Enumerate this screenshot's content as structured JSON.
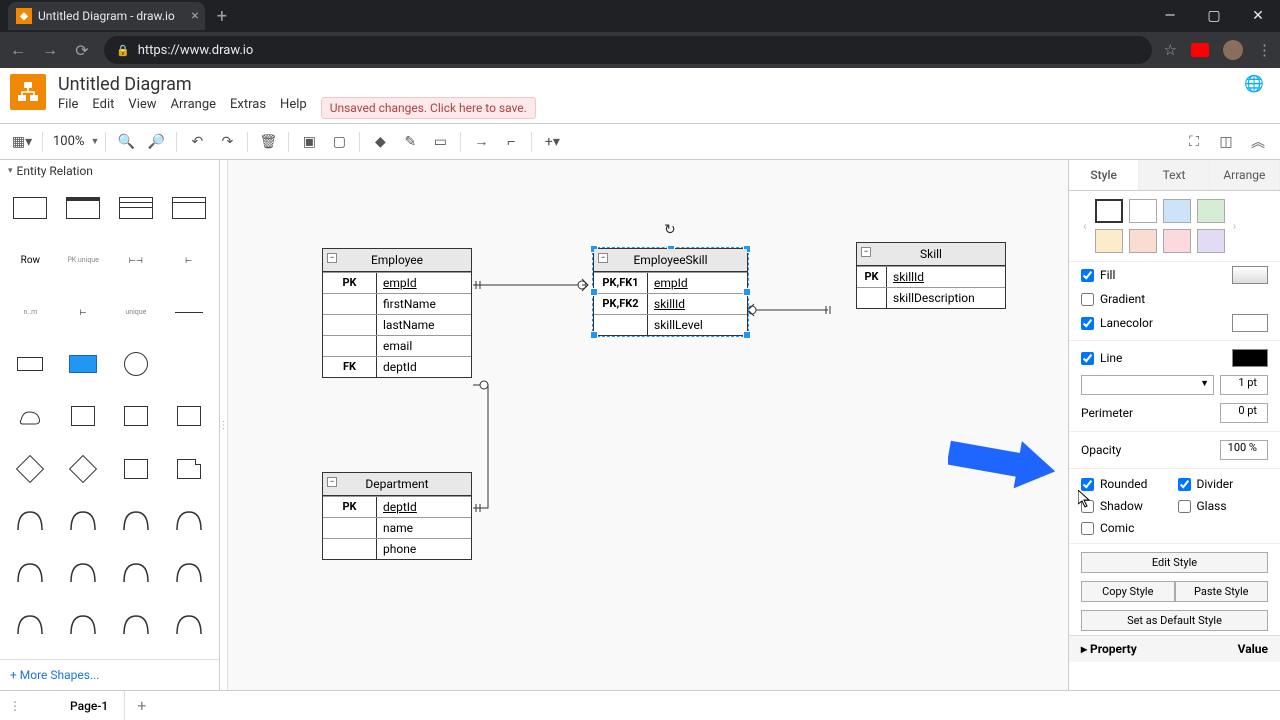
{
  "browser": {
    "tab_title": "Untitled Diagram - draw.io",
    "url": "https://www.draw.io"
  },
  "header": {
    "doc_title": "Untitled Diagram",
    "menu": [
      "File",
      "Edit",
      "View",
      "Arrange",
      "Extras",
      "Help"
    ],
    "unsaved": "Unsaved changes. Click here to save."
  },
  "toolbar": {
    "zoom": "100%"
  },
  "sidebar": {
    "section": "Entity Relation",
    "row_label": "Row",
    "more": "+ More Shapes..."
  },
  "canvas": {
    "tables": {
      "employee": {
        "title": "Employee",
        "rows": [
          {
            "key": "PK",
            "col": "empId",
            "u": true
          },
          {
            "key": "",
            "col": "firstName"
          },
          {
            "key": "",
            "col": "lastName"
          },
          {
            "key": "",
            "col": "email"
          },
          {
            "key": "FK",
            "col": "deptId"
          }
        ]
      },
      "employeeSkill": {
        "title": "EmployeeSkill",
        "rows": [
          {
            "key": "PK,FK1",
            "col": "empId",
            "u": true
          },
          {
            "key": "PK,FK2",
            "col": "skillId",
            "u": true
          },
          {
            "key": "",
            "col": "skillLevel"
          }
        ]
      },
      "skill": {
        "title": "Skill",
        "rows": [
          {
            "key": "PK",
            "col": "skillId",
            "u": true
          },
          {
            "key": "",
            "col": "skillDescription"
          }
        ]
      },
      "department": {
        "title": "Department",
        "rows": [
          {
            "key": "PK",
            "col": "deptId",
            "u": true
          },
          {
            "key": "",
            "col": "name"
          },
          {
            "key": "",
            "col": "phone"
          }
        ]
      }
    }
  },
  "rpanel": {
    "tabs": [
      "Style",
      "Text",
      "Arrange"
    ],
    "swatches1": [
      "#ffffff",
      "#eeeeee",
      "#cde3f8",
      "#d5ecd5"
    ],
    "swatches2": [
      "#fdeccc",
      "#f9dcd2",
      "#fbd9df",
      "#e3daf3"
    ],
    "fill": {
      "label": "Fill",
      "checked": true,
      "color": ""
    },
    "gradient": {
      "label": "Gradient",
      "checked": false
    },
    "lanecolor": {
      "label": "Lanecolor",
      "checked": true,
      "color": "#ffffff"
    },
    "line": {
      "label": "Line",
      "checked": true,
      "color": "#000000",
      "width": "1 pt"
    },
    "perimeter": {
      "label": "Perimeter",
      "value": "0 pt"
    },
    "opacity": {
      "label": "Opacity",
      "value": "100 %"
    },
    "flags": {
      "rounded": {
        "label": "Rounded",
        "checked": true
      },
      "divider": {
        "label": "Divider",
        "checked": true
      },
      "shadow": {
        "label": "Shadow",
        "checked": false
      },
      "glass": {
        "label": "Glass",
        "checked": false
      },
      "comic": {
        "label": "Comic",
        "checked": false
      }
    },
    "edit_style": "Edit Style",
    "copy_style": "Copy Style",
    "paste_style": "Paste Style",
    "default_style": "Set as Default Style",
    "prop_header": {
      "p": "Property",
      "v": "Value"
    }
  },
  "page_bar": {
    "page": "Page-1"
  }
}
